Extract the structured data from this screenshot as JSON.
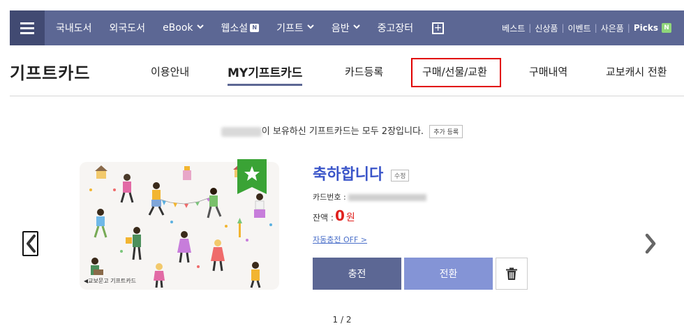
{
  "nav": {
    "items": [
      {
        "label": "국내도서",
        "chevron": false,
        "badge": ""
      },
      {
        "label": "외국도서",
        "chevron": false,
        "badge": ""
      },
      {
        "label": "eBook",
        "chevron": true,
        "badge": ""
      },
      {
        "label": "웹소설",
        "chevron": false,
        "badge": "N"
      },
      {
        "label": "기프트",
        "chevron": true,
        "badge": ""
      },
      {
        "label": "음반",
        "chevron": true,
        "badge": ""
      },
      {
        "label": "중고장터",
        "chevron": false,
        "badge": ""
      }
    ],
    "right_links": [
      "베스트",
      "신상품",
      "이벤트",
      "사은품",
      "Picks"
    ],
    "picks_badge": "N",
    "bg_color": "#5c6794"
  },
  "page": {
    "title": "기프트카드",
    "tabs": [
      "이용안내",
      "MY기프트카드",
      "카드등록",
      "구매/선물/교환",
      "구매내역",
      "교보캐시 전환"
    ],
    "active_tab": "MY기프트카드",
    "highlighted_tab": "구매/선물/교환"
  },
  "info": {
    "text": "이 보유하신 기프트카드는 모두 2장입니다.",
    "add_button": "추가 등록"
  },
  "card": {
    "brand_label": "◀교보문고 기프트카드",
    "title": "축하합니다",
    "edit_label": "수정",
    "number_label": "카드번호 :",
    "balance_label": "잔액 :",
    "balance_value": "0",
    "balance_unit": "원",
    "auto_charge": "자동충전 OFF >",
    "accent_color": "#3a55c9",
    "ribbon_color": "#3aa335"
  },
  "actions": {
    "charge": "충전",
    "convert": "전환"
  },
  "pager": "1 / 2"
}
